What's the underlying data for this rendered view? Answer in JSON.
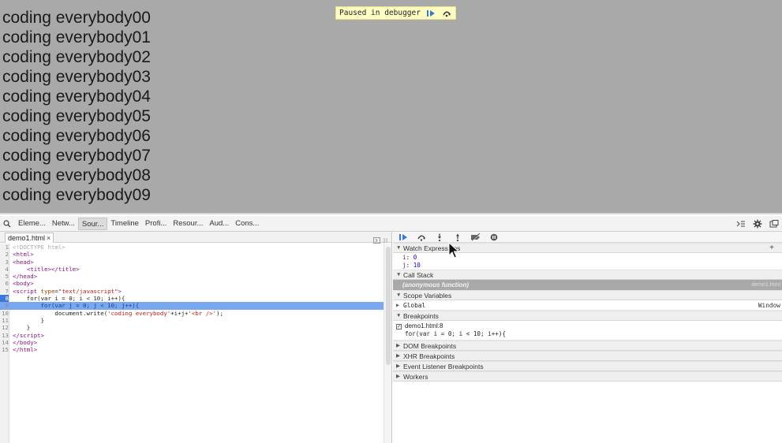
{
  "page": {
    "lines": [
      "coding everybody00",
      "coding everybody01",
      "coding everybody02",
      "coding everybody03",
      "coding everybody04",
      "coding everybody05",
      "coding everybody06",
      "coding everybody07",
      "coding everybody08",
      "coding everybody09"
    ]
  },
  "overlay": {
    "text": "Paused in debugger",
    "resume_icon": "resume-icon",
    "step_icon": "step-over-icon"
  },
  "devtools": {
    "tabs": [
      "Eleme...",
      "Netw...",
      "Sour...",
      "Timeline",
      "Profi...",
      "Resour...",
      "Aud...",
      "Cons..."
    ],
    "active_tab": "Sour...",
    "file_tab": {
      "name": "demo1.html",
      "close": "×"
    },
    "code": [
      {
        "n": "1",
        "html": "<span class='doc'>&lt;!DOCTYPE html&gt;</span>"
      },
      {
        "n": "2",
        "html": "<span class='tag'>&lt;html&gt;</span>"
      },
      {
        "n": "3",
        "html": "<span class='tag'>&lt;head&gt;</span>"
      },
      {
        "n": "4",
        "html": "    <span class='tag'>&lt;title&gt;&lt;/title&gt;</span>"
      },
      {
        "n": "5",
        "html": "<span class='tag'>&lt;/head&gt;</span>"
      },
      {
        "n": "6",
        "html": "<span class='tag'>&lt;body&gt;</span>"
      },
      {
        "n": "7",
        "html": "<span class='tag'>&lt;script</span> <span class='attr'>type</span>=<span class='str'>\"text/javascript\"</span><span class='tag'>&gt;</span>"
      },
      {
        "n": "8",
        "html": "    for(var i = 0; i &lt; 10; i++){",
        "bp": true
      },
      {
        "n": "9",
        "html": "        for(var j = 0; j &lt; 10; j++){",
        "exec": true
      },
      {
        "n": "10",
        "html": "            document.write(<span class='str'>'coding everybody'</span>+i+j+<span class='str'>'&lt;br /&gt;'</span>);"
      },
      {
        "n": "11",
        "html": "        }"
      },
      {
        "n": "12",
        "html": "    }"
      },
      {
        "n": "13",
        "html": "<span class='tag'>&lt;/script&gt;</span>"
      },
      {
        "n": "14",
        "html": "<span class='tag'>&lt;/body&gt;</span>"
      },
      {
        "n": "15",
        "html": "<span class='tag'>&lt;/html&gt;</span>"
      }
    ]
  },
  "sidebar": {
    "watch": {
      "title": "Watch Expressions",
      "add": "+",
      "items": [
        {
          "name": "i",
          "value": "0"
        },
        {
          "name": "j",
          "value": "10"
        }
      ]
    },
    "callstack": {
      "title": "Call Stack",
      "frame": "(anonymous function)",
      "location": "demo1.html"
    },
    "scope": {
      "title": "Scope Variables",
      "global": "Global",
      "global_value": "Window"
    },
    "breakpoints": {
      "title": "Breakpoints",
      "file": "demo1.html:8",
      "code": "for(var i = 0; i < 10; i++){"
    },
    "collapsed": [
      "DOM Breakpoints",
      "XHR Breakpoints",
      "Event Listener Breakpoints",
      "Workers"
    ]
  },
  "colors": {
    "exec_line": "#7aa8ef",
    "breakpoint": "#3c78d8",
    "overlay_bg": "#ffffc4"
  }
}
